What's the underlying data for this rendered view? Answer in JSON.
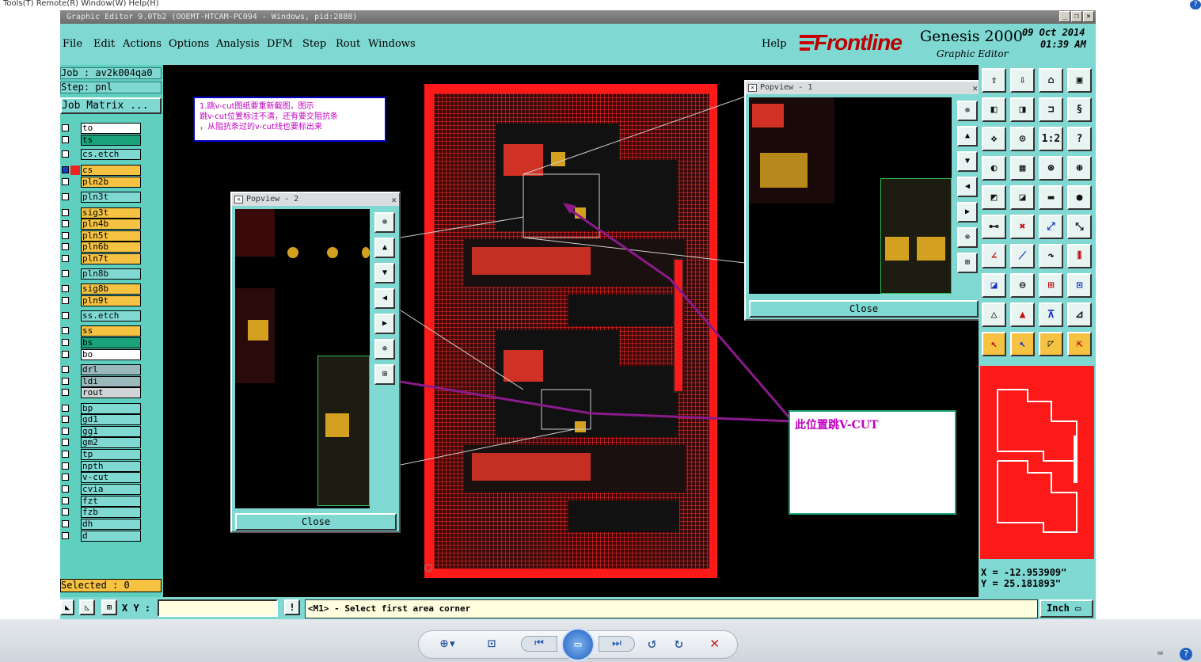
{
  "top_menu": "Tools(T)   Remote(R)   Window(W)   Help(H)",
  "window": {
    "title": "Graphic Editor 9.0Tb2 (OOEMT-HTCAM-PC094 - Windows, pid:2888)"
  },
  "menu": [
    "File",
    "Edit",
    "Actions",
    "Options",
    "Analysis",
    "DFM",
    "Step",
    "Rout",
    "Windows"
  ],
  "help_label": "Help",
  "logo": {
    "brand": "Frontline",
    "product": "Genesis 2000",
    "subtitle": "Graphic Editor",
    "date": "09 Oct 2014",
    "time": "01:39 AM"
  },
  "job": {
    "job_label": "Job : av2k004qa0",
    "step_label": "Step: pnl",
    "matrix_button": "Job Matrix ..."
  },
  "layers": [
    {
      "name": "to",
      "color": "#ffffff"
    },
    {
      "name": "ts",
      "color": "#1aa37a"
    },
    {
      "name": "cs.etch",
      "color": "#7fd8d2"
    },
    {
      "name": "cs",
      "color": "#f5c242"
    },
    {
      "name": "pln2b",
      "color": "#f5c242"
    },
    {
      "name": "pln3t",
      "color": "#7fd8d2"
    },
    {
      "name": "sig3t",
      "color": "#f5c242"
    },
    {
      "name": "pln4b",
      "color": "#f5c242"
    },
    {
      "name": "pln5t",
      "color": "#f5c242"
    },
    {
      "name": "pln6b",
      "color": "#f5c242"
    },
    {
      "name": "pln7t",
      "color": "#f5c242"
    },
    {
      "name": "pln8b",
      "color": "#7fd8d2"
    },
    {
      "name": "sig8b",
      "color": "#f5c242"
    },
    {
      "name": "pln9t",
      "color": "#f5c242"
    },
    {
      "name": "ss.etch",
      "color": "#7fd8d2"
    },
    {
      "name": "ss",
      "color": "#f5c242"
    },
    {
      "name": "bs",
      "color": "#1aa37a"
    },
    {
      "name": "bo",
      "color": "#ffffff"
    },
    {
      "name": "drl",
      "color": "#9bb8bc"
    },
    {
      "name": "ldi",
      "color": "#9bb8bc"
    },
    {
      "name": "rout",
      "color": "#d0d4d6"
    },
    {
      "name": "bp",
      "color": "#7fd8d2"
    },
    {
      "name": "gd1",
      "color": "#7fd8d2"
    },
    {
      "name": "gg1",
      "color": "#7fd8d2"
    },
    {
      "name": "gm2",
      "color": "#7fd8d2"
    },
    {
      "name": "tp",
      "color": "#7fd8d2"
    },
    {
      "name": "npth",
      "color": "#7fd8d2"
    },
    {
      "name": "v-cut",
      "color": "#7fd8d2"
    },
    {
      "name": "cvia",
      "color": "#7fd8d2"
    },
    {
      "name": "fzt",
      "color": "#7fd8d2"
    },
    {
      "name": "fzb",
      "color": "#7fd8d2"
    },
    {
      "name": "dh",
      "color": "#7fd8d2"
    },
    {
      "name": "d",
      "color": "#7fd8d2"
    }
  ],
  "selected_label": "Selected : 0",
  "annotation_note": {
    "line1": "1.跳v-cut图纸要重新截图，图示",
    "line2": "跳v-cut位置标注不清，还有要交阻抗条",
    "line3": "，从阻抗条过的v-cut线也要标出来"
  },
  "callout": "此位置跳V-CUT",
  "popview1": {
    "title": "Popview - 1",
    "close": "Close"
  },
  "popview2": {
    "title": "Popview - 2",
    "close": "Close"
  },
  "coords": {
    "x": "X = -12.953909\"",
    "y": "Y = 25.181893\""
  },
  "status": {
    "xy_label": "X Y :",
    "xy_value": "",
    "message": "<M1> - Select first area corner",
    "units": "Inch"
  },
  "toolbar_icons": [
    "zoom-icon",
    "fit-icon",
    "prev-icon",
    "slideshow-icon",
    "next-icon",
    "rotate-left-icon",
    "rotate-right-icon",
    "delete-icon"
  ],
  "colors": {
    "accent": "#7fd8d2",
    "board_red": "#ff1a1a",
    "annotation_purple": "#8b1a8b"
  }
}
